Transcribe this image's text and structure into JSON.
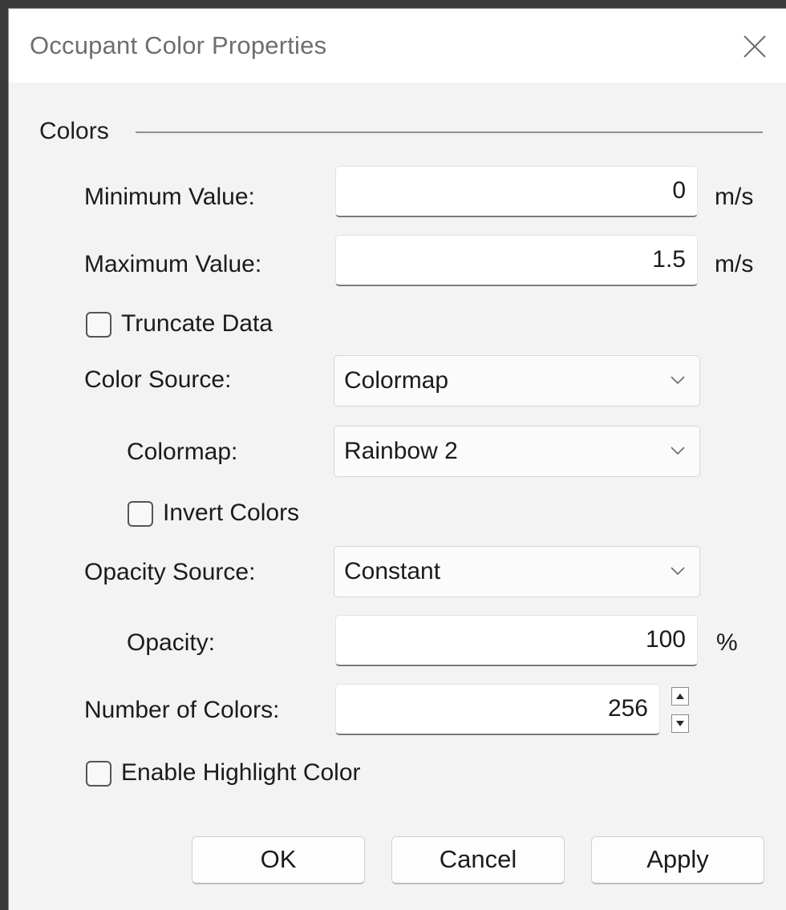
{
  "window": {
    "title": "Occupant Color Properties",
    "close_icon": "close-icon"
  },
  "group": {
    "label": "Colors"
  },
  "min_value": {
    "label": "Minimum Value:",
    "value": "0",
    "unit": "m/s"
  },
  "max_value": {
    "label": "Maximum Value:",
    "value": "1.5",
    "unit": "m/s"
  },
  "truncate": {
    "label": "Truncate Data",
    "checked": false
  },
  "color_source": {
    "label": "Color Source:",
    "selected": "Colormap",
    "icon": "chevron-down-icon"
  },
  "colormap": {
    "label": "Colormap:",
    "selected": "Rainbow 2",
    "icon": "chevron-down-icon"
  },
  "invert": {
    "label": "Invert Colors",
    "checked": false
  },
  "opacity_source": {
    "label": "Opacity Source:",
    "selected": "Constant",
    "icon": "chevron-down-icon"
  },
  "opacity": {
    "label": "Opacity:",
    "value": "100",
    "unit": "%"
  },
  "num_colors": {
    "label": "Number of Colors:",
    "value": "256",
    "up_icon": "spin-up-icon",
    "down_icon": "spin-down-icon"
  },
  "highlight": {
    "label": "Enable Highlight Color",
    "checked": false
  },
  "buttons": {
    "ok": "OK",
    "cancel": "Cancel",
    "apply": "Apply"
  },
  "colors": {
    "dialog_bg": "#f3f3f3",
    "titlebar_bg": "#ffffff",
    "text": "#1b1b1b",
    "title_text": "#6e6e6e"
  }
}
